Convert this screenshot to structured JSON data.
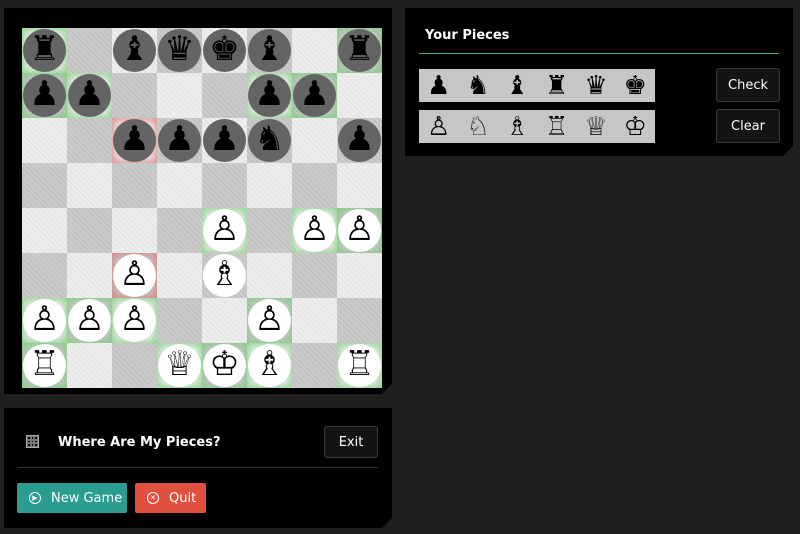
{
  "board": {
    "rows": [
      [
        {
          "p": "♜",
          "c": "black",
          "h": "green"
        },
        {
          "p": "",
          "c": "",
          "h": ""
        },
        {
          "p": "♝",
          "c": "black",
          "h": ""
        },
        {
          "p": "♛",
          "c": "black",
          "h": ""
        },
        {
          "p": "♚",
          "c": "black",
          "h": ""
        },
        {
          "p": "♝",
          "c": "black",
          "h": ""
        },
        {
          "p": "",
          "c": "",
          "h": ""
        },
        {
          "p": "♜",
          "c": "black",
          "h": "green"
        }
      ],
      [
        {
          "p": "♟",
          "c": "black",
          "h": "green"
        },
        {
          "p": "♟",
          "c": "black",
          "h": "green"
        },
        {
          "p": "",
          "c": "",
          "h": ""
        },
        {
          "p": "",
          "c": "",
          "h": ""
        },
        {
          "p": "",
          "c": "",
          "h": ""
        },
        {
          "p": "♟",
          "c": "black",
          "h": "green"
        },
        {
          "p": "♟",
          "c": "black",
          "h": "green"
        },
        {
          "p": "",
          "c": "",
          "h": ""
        }
      ],
      [
        {
          "p": "",
          "c": "",
          "h": ""
        },
        {
          "p": "",
          "c": "",
          "h": ""
        },
        {
          "p": "♟",
          "c": "black",
          "h": "red"
        },
        {
          "p": "♟",
          "c": "black",
          "h": ""
        },
        {
          "p": "♟",
          "c": "black",
          "h": ""
        },
        {
          "p": "♞",
          "c": "black",
          "h": ""
        },
        {
          "p": "",
          "c": "",
          "h": ""
        },
        {
          "p": "♟",
          "c": "black",
          "h": ""
        }
      ],
      [
        {
          "p": "",
          "c": "",
          "h": ""
        },
        {
          "p": "",
          "c": "",
          "h": ""
        },
        {
          "p": "",
          "c": "",
          "h": ""
        },
        {
          "p": "",
          "c": "",
          "h": ""
        },
        {
          "p": "",
          "c": "",
          "h": ""
        },
        {
          "p": "",
          "c": "",
          "h": ""
        },
        {
          "p": "",
          "c": "",
          "h": ""
        },
        {
          "p": "",
          "c": "",
          "h": ""
        }
      ],
      [
        {
          "p": "",
          "c": "",
          "h": ""
        },
        {
          "p": "",
          "c": "",
          "h": ""
        },
        {
          "p": "",
          "c": "",
          "h": ""
        },
        {
          "p": "",
          "c": "",
          "h": ""
        },
        {
          "p": "♙",
          "c": "white",
          "h": "green"
        },
        {
          "p": "",
          "c": "",
          "h": ""
        },
        {
          "p": "♙",
          "c": "white",
          "h": "green"
        },
        {
          "p": "♙",
          "c": "white",
          "h": "green"
        }
      ],
      [
        {
          "p": "",
          "c": "",
          "h": ""
        },
        {
          "p": "",
          "c": "",
          "h": ""
        },
        {
          "p": "♙",
          "c": "white",
          "h": "red"
        },
        {
          "p": "",
          "c": "",
          "h": ""
        },
        {
          "p": "♗",
          "c": "white",
          "h": ""
        },
        {
          "p": "",
          "c": "",
          "h": ""
        },
        {
          "p": "",
          "c": "",
          "h": ""
        },
        {
          "p": "",
          "c": "",
          "h": ""
        }
      ],
      [
        {
          "p": "♙",
          "c": "white",
          "h": "green"
        },
        {
          "p": "♙",
          "c": "white",
          "h": "green"
        },
        {
          "p": "♙",
          "c": "white",
          "h": "green"
        },
        {
          "p": "",
          "c": "",
          "h": ""
        },
        {
          "p": "",
          "c": "",
          "h": ""
        },
        {
          "p": "♙",
          "c": "white",
          "h": "green"
        },
        {
          "p": "",
          "c": "",
          "h": ""
        },
        {
          "p": "",
          "c": "",
          "h": ""
        }
      ],
      [
        {
          "p": "♖",
          "c": "white",
          "h": "green"
        },
        {
          "p": "",
          "c": "",
          "h": ""
        },
        {
          "p": "",
          "c": "",
          "h": ""
        },
        {
          "p": "♕",
          "c": "white",
          "h": "green"
        },
        {
          "p": "♔",
          "c": "white",
          "h": "green"
        },
        {
          "p": "♗",
          "c": "white",
          "h": "green"
        },
        {
          "p": "",
          "c": "",
          "h": ""
        },
        {
          "p": "♖",
          "c": "white",
          "h": "green"
        }
      ]
    ]
  },
  "side": {
    "title": "Your Pieces",
    "tray_black": [
      "♟",
      "♞",
      "♝",
      "♜",
      "♛",
      "♚"
    ],
    "tray_white": [
      "♙",
      "♘",
      "♗",
      "♖",
      "♕",
      "♔"
    ],
    "check_label": "Check",
    "clear_label": "Clear"
  },
  "bottom": {
    "title": "Where Are My Pieces?",
    "exit_label": "Exit",
    "new_game_label": "New Game",
    "quit_label": "Quit"
  },
  "colors": {
    "accent_teal": "#2a9d8f",
    "quit_red": "#e0503e",
    "highlight_green": "#6ecd6e",
    "highlight_red": "#dc6e6e"
  },
  "icons": {
    "play": "play-circle-icon",
    "quit": "x-circle-icon",
    "puzzle": "grid-icon"
  }
}
